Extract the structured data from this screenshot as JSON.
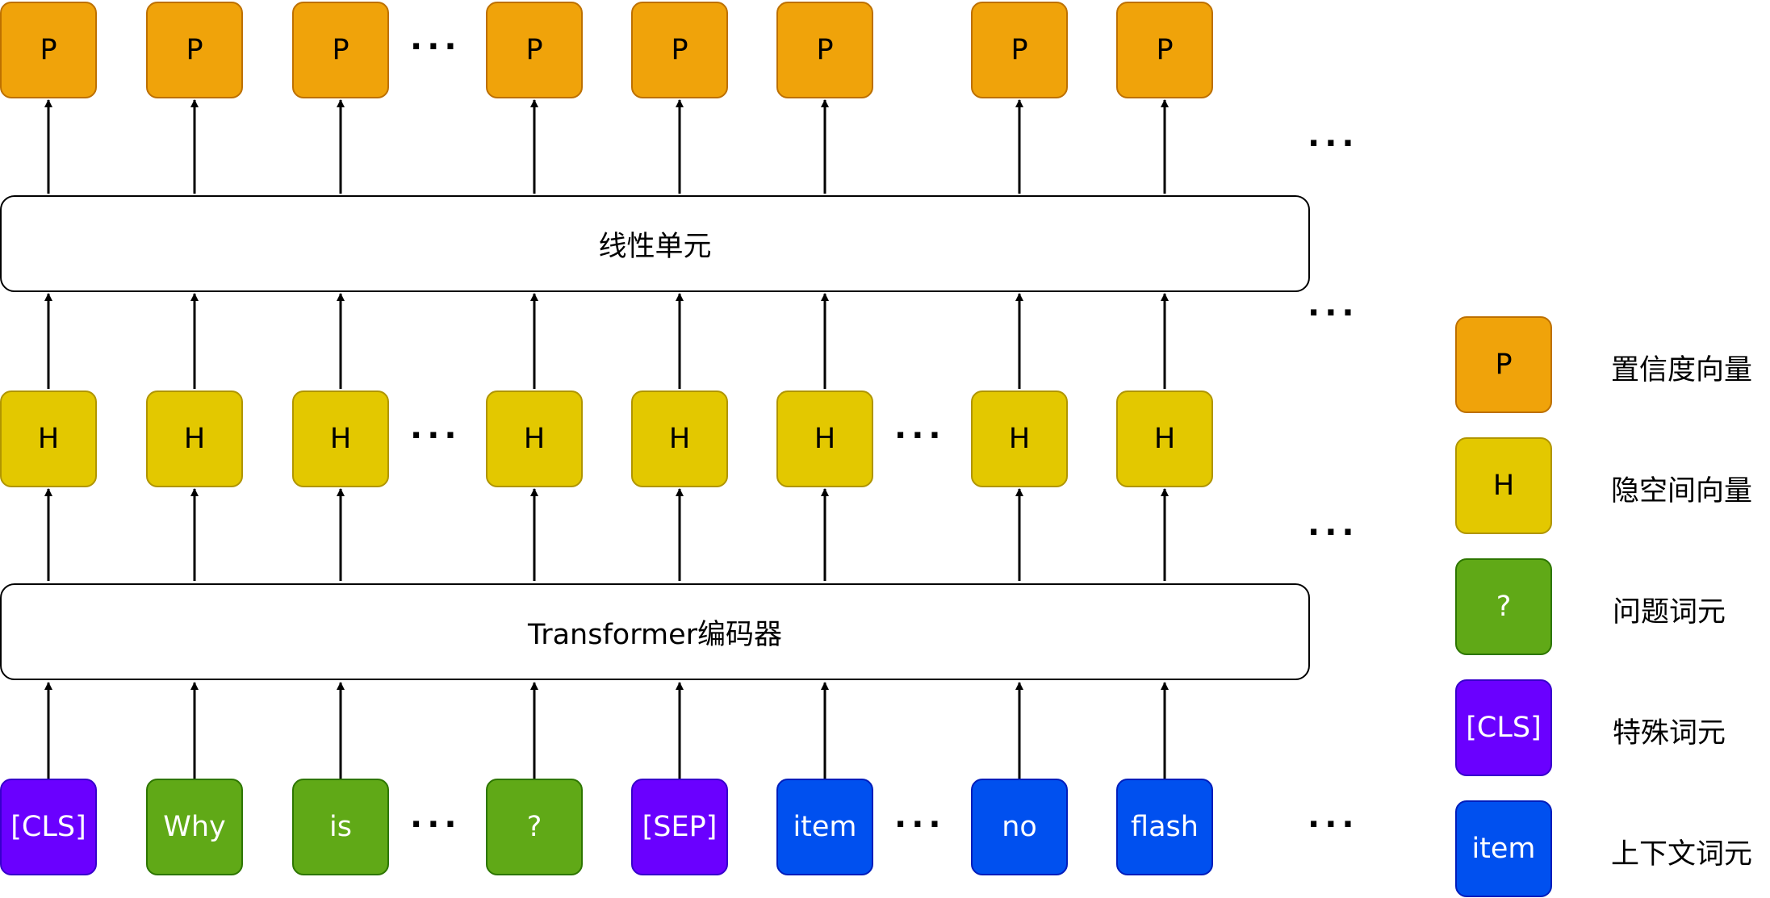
{
  "colors": {
    "orange": {
      "fill": "#F0A30A",
      "stroke": "#BD7000"
    },
    "yellow": {
      "fill": "#E3C800",
      "stroke": "#B09500"
    },
    "green": {
      "fill": "#60A917",
      "stroke": "#2D7600"
    },
    "purple": {
      "fill": "#6A00FF",
      "stroke": "#3700CC"
    },
    "blue": {
      "fill": "#0050EF",
      "stroke": "#001DBC"
    }
  },
  "rows": {
    "output": [
      "P",
      "P",
      "P",
      "P",
      "P",
      "P",
      "P",
      "P"
    ],
    "hidden": [
      "H",
      "H",
      "H",
      "H",
      "H",
      "H",
      "H",
      "H"
    ],
    "input": [
      "[CLS]",
      "Why",
      "is",
      "?",
      "[SEP]",
      "item",
      "no",
      "flash"
    ]
  },
  "input_types": [
    "special",
    "question",
    "question",
    "question",
    "special",
    "context",
    "context",
    "context"
  ],
  "linear_label": "线性单元",
  "encoder_label": "Transformer编码器",
  "ellipsis": "···",
  "legend": [
    {
      "symbol": "P",
      "label": "置信度向量",
      "color": "orange"
    },
    {
      "symbol": "H",
      "label": "隐空间向量",
      "color": "yellow"
    },
    {
      "symbol": "?",
      "label": "问题词元",
      "color": "green"
    },
    {
      "symbol": "[CLS]",
      "label": "特殊词元",
      "color": "purple"
    },
    {
      "symbol": "item",
      "label": "上下文词元",
      "color": "blue"
    }
  ]
}
